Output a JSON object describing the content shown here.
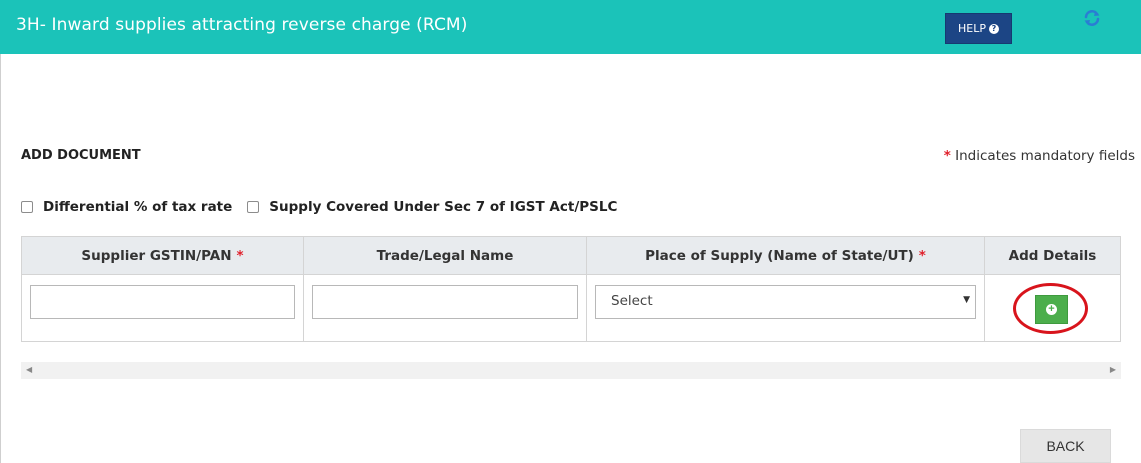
{
  "header": {
    "title": "3H- Inward supplies attracting reverse charge (RCM)",
    "help_label": "HELP",
    "help_icon": "question-circle-icon",
    "refresh_icon": "refresh-icon",
    "bg_color": "#1bc3b9"
  },
  "section": {
    "title": "ADD DOCUMENT",
    "mandatory_star": "*",
    "mandatory_note": "Indicates mandatory fields"
  },
  "checkboxes": [
    {
      "label": "Differential % of tax rate",
      "checked": false
    },
    {
      "label": "Supply Covered Under Sec 7 of IGST Act/PSLC",
      "checked": false
    }
  ],
  "table": {
    "columns": [
      {
        "label": "Supplier GSTIN/PAN",
        "required": "*"
      },
      {
        "label": "Trade/Legal Name",
        "required": ""
      },
      {
        "label": "Place of Supply (Name of State/UT)",
        "required": "*"
      },
      {
        "label": "Add Details",
        "required": ""
      }
    ],
    "row": {
      "supplier_gstin": "",
      "trade_name": "",
      "place_of_supply": "Select",
      "add_icon": "plus-circle-icon"
    }
  },
  "footer": {
    "back_label": "BACK"
  },
  "colors": {
    "accent": "#1bc3b9",
    "help_btn": "#1c4585",
    "add_btn": "#4cae4c",
    "required": "#e0202b",
    "highlight": "#d8141c"
  }
}
